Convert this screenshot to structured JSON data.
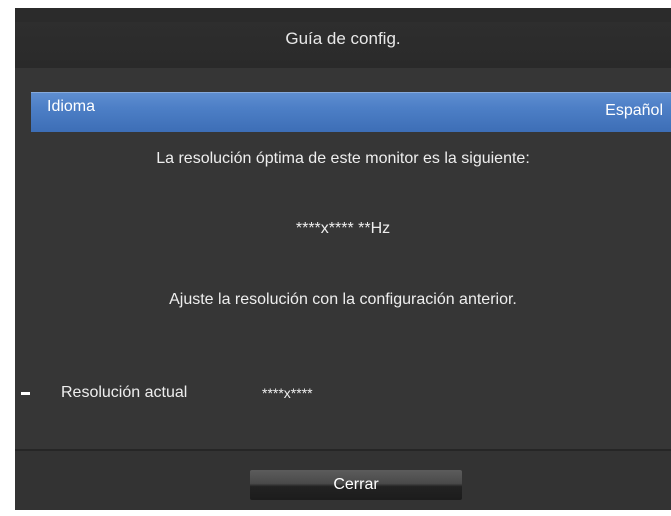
{
  "dialog": {
    "title": "Guía de config."
  },
  "language": {
    "label": "Idioma",
    "value": "Español"
  },
  "message": {
    "optimal_intro": "La resolución óptima de este monitor es la siguiente:",
    "optimal_resolution": "****x**** **Hz",
    "adjust_instruction": "Ajuste la resolución con la configuración anterior."
  },
  "current_resolution": {
    "label": "Resolución actual",
    "value": "****x****"
  },
  "footer": {
    "close_label": "Cerrar"
  },
  "colors": {
    "panel_background": "#363636",
    "selected_row": "#4d7fc6",
    "text": "#eeeeee"
  }
}
